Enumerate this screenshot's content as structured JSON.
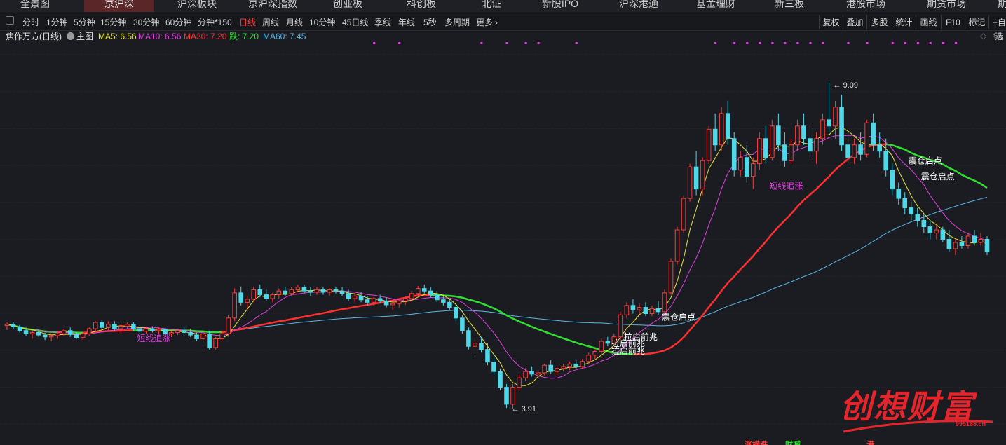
{
  "nav": {
    "tabs": [
      {
        "label": "全景图",
        "active": false
      },
      {
        "label": "京沪深",
        "active": true
      },
      {
        "label": "沪深板块",
        "active": false
      },
      {
        "label": "京沪深指数",
        "active": false
      },
      {
        "label": "创业板",
        "active": false
      },
      {
        "label": "科创板",
        "active": false
      },
      {
        "label": "北证",
        "active": false
      },
      {
        "label": "新股IPO",
        "active": false
      },
      {
        "label": "沪深港通",
        "active": false
      },
      {
        "label": "基金理财",
        "active": false
      },
      {
        "label": "新三板",
        "active": false
      },
      {
        "label": "港股市场",
        "active": false
      },
      {
        "label": "期货市场",
        "active": false
      },
      {
        "label": "期",
        "active": false
      }
    ]
  },
  "toolbar": {
    "periods": [
      {
        "label": "分时",
        "active": false
      },
      {
        "label": "1分钟",
        "active": false
      },
      {
        "label": "5分钟",
        "active": false
      },
      {
        "label": "15分钟",
        "active": false
      },
      {
        "label": "30分钟",
        "active": false
      },
      {
        "label": "60分钟",
        "active": false
      },
      {
        "label": "分钟*150",
        "active": false
      },
      {
        "label": "日线",
        "active": true
      },
      {
        "label": "周线",
        "active": false
      },
      {
        "label": "月线",
        "active": false
      },
      {
        "label": "10分钟",
        "active": false
      },
      {
        "label": "45日线",
        "active": false
      },
      {
        "label": "季线",
        "active": false
      },
      {
        "label": "年线",
        "active": false
      },
      {
        "label": "5秒",
        "active": false
      },
      {
        "label": "多周期",
        "active": false
      },
      {
        "label": "更多",
        "active": false
      }
    ],
    "right_buttons": [
      "复权",
      "叠加",
      "多股",
      "统计",
      "画线",
      "F10",
      "标记",
      "+自选"
    ]
  },
  "legend": {
    "stock_name": "焦作万方(日线)",
    "main_label": "主图",
    "ma": [
      {
        "label": "MA5: 6.56",
        "color": "#e8e43a"
      },
      {
        "label": "MA10: 6.56",
        "color": "#e040e0"
      },
      {
        "label": "MA30: 7.20",
        "color": "#ff3030"
      },
      {
        "label": "跌: 7.20",
        "color": "#30e030"
      },
      {
        "label": "MA60: 7.45",
        "color": "#5ab8e8"
      }
    ]
  },
  "chart_data": {
    "type": "candlestick",
    "ylim": [
      3.5,
      9.6
    ],
    "high_label": "9.09",
    "low_label": "3.91",
    "candles": [
      [
        5.23,
        5.28,
        5.16,
        5.25
      ],
      [
        5.25,
        5.28,
        5.18,
        5.21
      ],
      [
        5.21,
        5.24,
        5.12,
        5.15
      ],
      [
        5.15,
        5.2,
        5.07,
        5.1
      ],
      [
        5.1,
        5.15,
        5.02,
        5.12
      ],
      [
        5.12,
        5.18,
        5.05,
        5.08
      ],
      [
        5.08,
        5.12,
        5.0,
        5.05
      ],
      [
        5.05,
        5.1,
        4.98,
        5.07
      ],
      [
        5.07,
        5.14,
        5.02,
        5.1
      ],
      [
        5.1,
        5.18,
        5.06,
        5.15
      ],
      [
        5.15,
        5.2,
        5.05,
        5.09
      ],
      [
        5.09,
        5.13,
        5.02,
        5.04
      ],
      [
        5.04,
        5.12,
        5.0,
        5.1
      ],
      [
        5.1,
        5.2,
        5.06,
        5.18
      ],
      [
        5.18,
        5.3,
        5.15,
        5.28
      ],
      [
        5.28,
        5.32,
        5.18,
        5.2
      ],
      [
        5.2,
        5.3,
        5.15,
        5.25
      ],
      [
        5.25,
        5.3,
        5.15,
        5.18
      ],
      [
        5.18,
        5.25,
        5.1,
        5.22
      ],
      [
        5.22,
        5.28,
        5.18,
        5.25
      ],
      [
        5.25,
        5.28,
        5.15,
        5.18
      ],
      [
        5.18,
        5.22,
        5.1,
        5.14
      ],
      [
        5.14,
        5.2,
        5.1,
        5.18
      ],
      [
        5.18,
        5.22,
        5.12,
        5.15
      ],
      [
        5.15,
        5.2,
        5.1,
        5.17
      ],
      [
        5.17,
        5.2,
        5.08,
        5.1
      ],
      [
        5.1,
        5.15,
        5.05,
        5.12
      ],
      [
        5.12,
        5.18,
        5.08,
        5.15
      ],
      [
        5.15,
        5.2,
        5.1,
        5.12
      ],
      [
        5.12,
        5.18,
        5.05,
        5.08
      ],
      [
        5.08,
        5.12,
        4.98,
        5.02
      ],
      [
        5.02,
        5.15,
        4.95,
        5.1
      ],
      [
        5.1,
        5.15,
        4.85,
        4.88
      ],
      [
        4.88,
        5.05,
        4.85,
        5.02
      ],
      [
        5.02,
        5.15,
        4.98,
        5.1
      ],
      [
        5.1,
        5.4,
        5.05,
        5.35
      ],
      [
        5.35,
        5.82,
        5.3,
        5.75
      ],
      [
        5.75,
        5.85,
        5.55,
        5.6
      ],
      [
        5.6,
        5.7,
        5.5,
        5.65
      ],
      [
        5.65,
        5.85,
        5.6,
        5.8
      ],
      [
        5.8,
        5.88,
        5.68,
        5.72
      ],
      [
        5.72,
        5.8,
        5.62,
        5.66
      ],
      [
        5.66,
        5.75,
        5.6,
        5.72
      ],
      [
        5.72,
        5.82,
        5.66,
        5.78
      ],
      [
        5.78,
        5.85,
        5.7,
        5.74
      ],
      [
        5.74,
        5.84,
        5.7,
        5.8
      ],
      [
        5.8,
        5.88,
        5.76,
        5.84
      ],
      [
        5.84,
        5.88,
        5.74,
        5.78
      ],
      [
        5.78,
        5.84,
        5.7,
        5.76
      ],
      [
        5.76,
        5.84,
        5.72,
        5.8
      ],
      [
        5.8,
        5.85,
        5.72,
        5.76
      ],
      [
        5.76,
        5.82,
        5.7,
        5.8
      ],
      [
        5.8,
        5.85,
        5.74,
        5.78
      ],
      [
        5.78,
        5.84,
        5.7,
        5.74
      ],
      [
        5.74,
        5.8,
        5.62,
        5.66
      ],
      [
        5.66,
        5.74,
        5.6,
        5.7
      ],
      [
        5.7,
        5.76,
        5.6,
        5.64
      ],
      [
        5.64,
        5.7,
        5.55,
        5.6
      ],
      [
        5.6,
        5.68,
        5.55,
        5.66
      ],
      [
        5.66,
        5.72,
        5.58,
        5.62
      ],
      [
        5.62,
        5.68,
        5.52,
        5.56
      ],
      [
        5.56,
        5.62,
        5.48,
        5.58
      ],
      [
        5.58,
        5.66,
        5.52,
        5.62
      ],
      [
        5.62,
        5.7,
        5.56,
        5.66
      ],
      [
        5.66,
        5.78,
        5.62,
        5.74
      ],
      [
        5.74,
        5.86,
        5.7,
        5.82
      ],
      [
        5.82,
        5.88,
        5.74,
        5.78
      ],
      [
        5.78,
        5.84,
        5.68,
        5.72
      ],
      [
        5.72,
        5.78,
        5.6,
        5.64
      ],
      [
        5.64,
        5.7,
        5.55,
        5.6
      ],
      [
        5.6,
        5.66,
        5.48,
        5.52
      ],
      [
        5.52,
        5.56,
        5.3,
        5.35
      ],
      [
        5.35,
        5.4,
        5.1,
        5.15
      ],
      [
        5.15,
        5.2,
        4.85,
        4.9
      ],
      [
        4.9,
        5.0,
        4.78,
        4.95
      ],
      [
        4.95,
        5.05,
        4.8,
        4.85
      ],
      [
        4.85,
        4.95,
        4.6,
        4.65
      ],
      [
        4.65,
        4.72,
        4.45,
        4.5
      ],
      [
        4.5,
        4.55,
        4.2,
        4.25
      ],
      [
        4.25,
        4.3,
        3.92,
        3.98
      ],
      [
        3.98,
        4.3,
        3.91,
        4.25
      ],
      [
        4.25,
        4.45,
        4.2,
        4.4
      ],
      [
        4.4,
        4.55,
        4.35,
        4.5
      ],
      [
        4.5,
        4.58,
        4.42,
        4.46
      ],
      [
        4.46,
        4.52,
        4.38,
        4.48
      ],
      [
        4.48,
        4.62,
        4.44,
        4.6
      ],
      [
        4.6,
        4.68,
        4.46,
        4.5
      ],
      [
        4.5,
        4.58,
        4.44,
        4.55
      ],
      [
        4.55,
        4.62,
        4.5,
        4.58
      ],
      [
        4.58,
        4.66,
        4.52,
        4.62
      ],
      [
        4.62,
        4.68,
        4.55,
        4.58
      ],
      [
        4.58,
        4.7,
        4.55,
        4.66
      ],
      [
        4.66,
        4.8,
        4.62,
        4.76
      ],
      [
        4.76,
        4.85,
        4.7,
        4.82
      ],
      [
        4.82,
        5.02,
        4.78,
        4.98
      ],
      [
        4.98,
        5.05,
        4.9,
        4.95
      ],
      [
        4.95,
        5.1,
        4.92,
        5.05
      ],
      [
        5.05,
        5.45,
        5.0,
        5.4
      ],
      [
        5.4,
        5.6,
        5.35,
        5.55
      ],
      [
        5.55,
        5.65,
        5.42,
        5.48
      ],
      [
        5.48,
        5.58,
        5.4,
        5.52
      ],
      [
        5.52,
        5.6,
        5.38,
        5.42
      ],
      [
        5.42,
        5.55,
        5.38,
        5.5
      ],
      [
        5.5,
        5.62,
        5.4,
        5.45
      ],
      [
        5.45,
        5.8,
        5.42,
        5.75
      ],
      [
        5.75,
        6.3,
        5.72,
        6.25
      ],
      [
        6.25,
        6.8,
        6.2,
        6.75
      ],
      [
        6.75,
        7.3,
        6.7,
        7.25
      ],
      [
        7.25,
        7.8,
        7.2,
        7.75
      ],
      [
        7.75,
        8.0,
        7.3,
        7.4
      ],
      [
        7.4,
        7.9,
        7.3,
        7.85
      ],
      [
        7.85,
        8.4,
        7.8,
        8.35
      ],
      [
        8.35,
        8.6,
        8.0,
        8.1
      ],
      [
        8.1,
        8.7,
        8.0,
        8.6
      ],
      [
        8.6,
        8.8,
        8.1,
        8.2
      ],
      [
        8.2,
        8.3,
        7.6,
        7.7
      ],
      [
        7.7,
        8.0,
        7.6,
        7.9
      ],
      [
        7.9,
        8.1,
        7.5,
        7.6
      ],
      [
        7.6,
        7.9,
        7.4,
        7.8
      ],
      [
        7.8,
        8.3,
        7.7,
        8.2
      ],
      [
        8.2,
        8.4,
        7.8,
        7.9
      ],
      [
        7.9,
        8.5,
        7.85,
        8.4
      ],
      [
        8.4,
        8.6,
        8.0,
        8.1
      ],
      [
        8.1,
        8.3,
        7.75,
        7.85
      ],
      [
        7.85,
        8.2,
        7.8,
        8.1
      ],
      [
        8.1,
        8.5,
        8.0,
        8.4
      ],
      [
        8.4,
        8.6,
        8.1,
        8.2
      ],
      [
        8.2,
        8.4,
        7.9,
        8.0
      ],
      [
        8.0,
        8.3,
        7.8,
        8.2
      ],
      [
        8.2,
        8.6,
        8.1,
        8.5
      ],
      [
        8.5,
        9.09,
        8.3,
        8.4
      ],
      [
        8.4,
        8.8,
        8.2,
        8.7
      ],
      [
        8.7,
        8.9,
        8.0,
        8.1
      ],
      [
        8.1,
        8.3,
        7.8,
        7.9
      ],
      [
        7.9,
        8.2,
        7.8,
        8.1
      ],
      [
        8.1,
        8.3,
        7.85,
        7.95
      ],
      [
        7.95,
        8.5,
        7.9,
        8.45
      ],
      [
        8.45,
        8.6,
        8.0,
        8.1
      ],
      [
        8.1,
        8.3,
        7.9,
        8.0
      ],
      [
        8.0,
        8.2,
        7.6,
        7.7
      ],
      [
        7.7,
        7.8,
        7.3,
        7.4
      ],
      [
        7.4,
        7.5,
        7.15,
        7.25
      ],
      [
        7.25,
        7.35,
        7.0,
        7.1
      ],
      [
        7.1,
        7.2,
        6.9,
        7.0
      ],
      [
        7.0,
        7.1,
        6.8,
        6.9
      ],
      [
        6.9,
        7.0,
        6.7,
        6.8
      ],
      [
        6.8,
        6.9,
        6.6,
        6.7
      ],
      [
        6.7,
        6.85,
        6.6,
        6.75
      ],
      [
        6.75,
        6.8,
        6.55,
        6.6
      ],
      [
        6.6,
        6.75,
        6.4,
        6.45
      ],
      [
        6.45,
        6.6,
        6.35,
        6.55
      ],
      [
        6.55,
        6.65,
        6.45,
        6.5
      ],
      [
        6.5,
        6.7,
        6.45,
        6.65
      ],
      [
        6.65,
        6.75,
        6.5,
        6.55
      ],
      [
        6.55,
        6.7,
        6.5,
        6.6
      ],
      [
        6.6,
        6.65,
        6.35,
        6.4
      ]
    ],
    "annotations": [
      {
        "label": "短线追涨",
        "index": 21,
        "price": 4.98,
        "color": "#e040e0"
      },
      {
        "label": "短线追涨",
        "index": 121,
        "price": 7.4,
        "color": "#e040e0"
      },
      {
        "label": "震仓启点",
        "index": 143,
        "price": 7.8,
        "color": "#ffffff"
      },
      {
        "label": "震仓启点",
        "index": 145,
        "price": 7.55,
        "color": "#ffffff"
      },
      {
        "label": "震仓启点",
        "index": 104,
        "price": 5.32,
        "color": "#ffffff"
      },
      {
        "label": "拉启前兆",
        "index": 98,
        "price": 5.0,
        "color": "#ffffff"
      },
      {
        "label": "拉启前兆",
        "index": 96,
        "price": 4.9,
        "color": "#ffffff"
      },
      {
        "label": "拉启前兆",
        "index": 96,
        "price": 4.78,
        "color": "#ffffff"
      }
    ],
    "bottom_labels": [
      {
        "label": "涨横跌",
        "color": "#ff3b3b"
      },
      {
        "label": "财减",
        "color": "#35e035"
      },
      {
        "label": "港",
        "color": "#ff3b3b"
      }
    ]
  },
  "watermark": {
    "text": "创想财富",
    "url": "995168.cn"
  }
}
